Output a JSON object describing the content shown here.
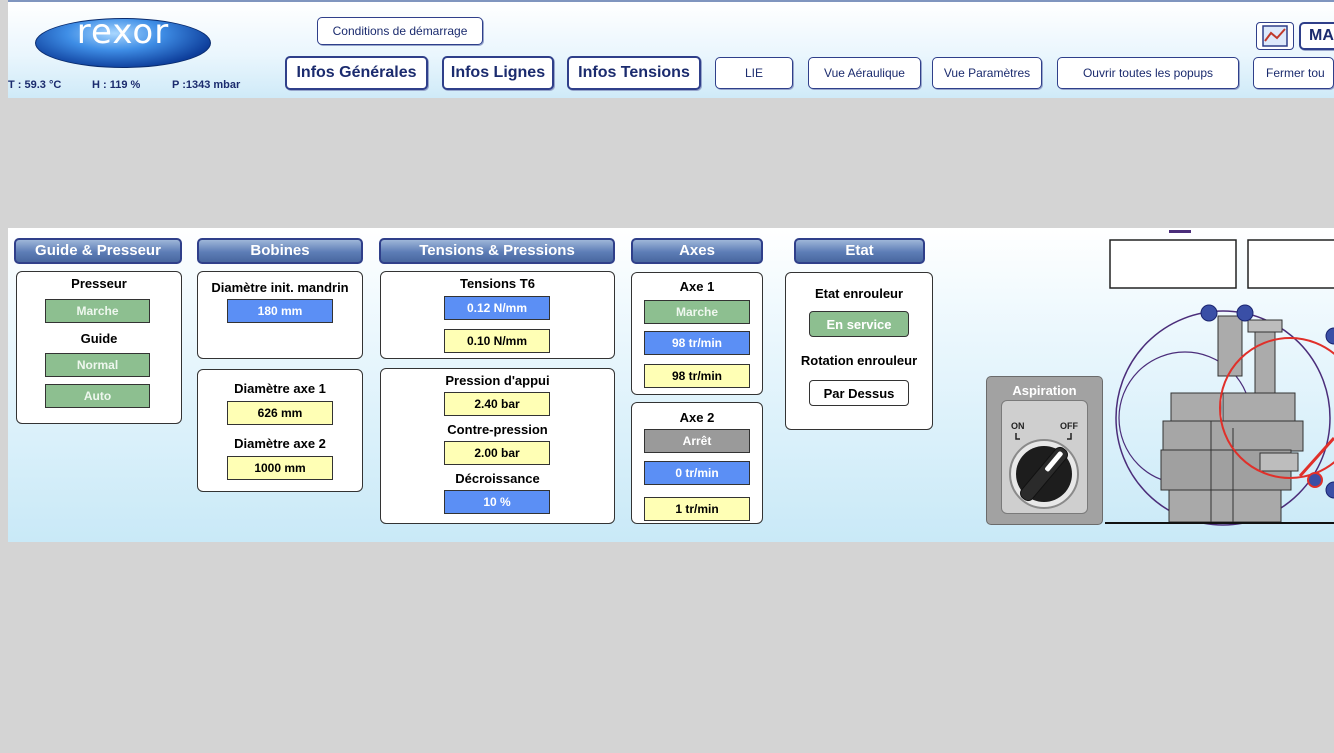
{
  "header": {
    "logo": "rexor",
    "env": {
      "temperature": "T : 59.3 °C",
      "humidity": "H : 119 %",
      "pressure": "P :1343 mbar"
    },
    "nav": {
      "conditions": "Conditions de démarrage",
      "infos_generales": "Infos Générales",
      "infos_lignes": "Infos Lignes",
      "infos_tensions": "Infos Tensions",
      "lie": "LIE",
      "vue_aeraulique": "Vue Aéraulique",
      "vue_parametres": "Vue Paramètres",
      "ouvrir_popups": "Ouvrir toutes les popups",
      "fermer_popups": "Fermer tou",
      "mode": "MA"
    }
  },
  "sections": {
    "guide_presseur": {
      "title": "Guide & Presseur",
      "presseur_label": "Presseur",
      "presseur_value": "Marche",
      "guide_label": "Guide",
      "guide_value": "Normal",
      "auto_value": "Auto"
    },
    "bobines": {
      "title": "Bobines",
      "diam_mandrin_label": "Diamètre init. mandrin",
      "diam_mandrin_value": "180 mm",
      "diam_axe1_label": "Diamètre axe 1",
      "diam_axe1_value": "626 mm",
      "diam_axe2_label": "Diamètre axe 2",
      "diam_axe2_value": "1000 mm"
    },
    "tensions": {
      "title": "Tensions & Pressions",
      "t6_label": "Tensions T6",
      "t6_setpoint": "0.12 N/mm",
      "t6_value": "0.10 N/mm",
      "pression_appui_label": "Pression d'appui",
      "pression_appui_value": "2.40 bar",
      "contre_pression_label": "Contre-pression",
      "contre_pression_value": "2.00 bar",
      "decroissance_label": "Décroissance",
      "decroissance_value": "10 %"
    },
    "axes": {
      "title": "Axes",
      "axe1_label": "Axe 1",
      "axe1_state": "Marche",
      "axe1_setpoint": "98 tr/min",
      "axe1_speed": "98 tr/min",
      "axe2_label": "Axe 2",
      "axe2_state": "Arrêt",
      "axe2_setpoint": "0 tr/min",
      "axe2_speed": "1 tr/min"
    },
    "etat": {
      "title": "Etat",
      "enrouleur_label": "Etat enrouleur",
      "enrouleur_value": "En service",
      "rotation_label": "Rotation enrouleur",
      "rotation_value": "Par Dessus"
    },
    "aspiration": {
      "title": "Aspiration",
      "on_label": "ON",
      "off_label": "OFF",
      "state": "ON"
    }
  },
  "colors": {
    "header_blue": "#5d7db6",
    "status_green": "#8dbf90",
    "value_blue": "#5b8ff5",
    "value_yellow": "#ffffb5",
    "state_gray": "#9a9a9a",
    "schematic_red": "#e0302a",
    "schematic_purple": "#4b2d7a"
  }
}
